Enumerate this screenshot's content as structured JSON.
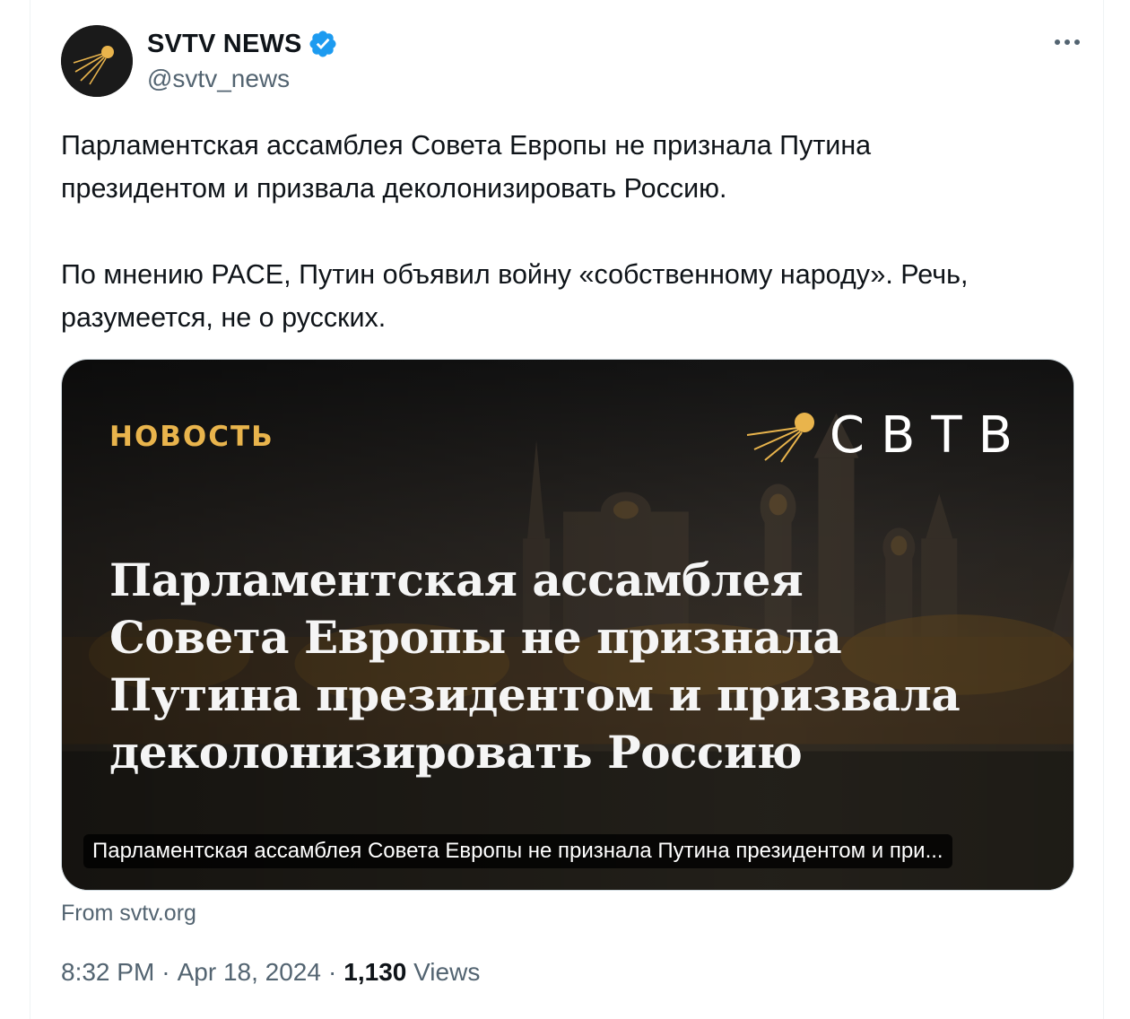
{
  "author": {
    "display_name": "SVTV NEWS",
    "handle": "@svtv_news",
    "verified": true,
    "verified_color": "#1d9bf0"
  },
  "tweet": {
    "text": "Парламентская ассамблея Совета Европы не признала Путина\nпрезидентом и призвала деколонизировать Россию.\n\nПо мнению PACE, Путин объявил войну «собственному народу». Речь,\nразумеется, не о русских."
  },
  "card": {
    "kicker": "НОВОСТЬ",
    "logo_text": "СВТВ",
    "headline": "Парламентская ассамблея Совета Европы не признала Путина президентом и призвала деколонизировать Россию",
    "caption": "Парламентская ассамблея Совета Европы не признала Путина президентом и при...",
    "source": "From svtv.org",
    "accent_color": "#e9b44c"
  },
  "meta": {
    "time": "8:32 PM",
    "separator1": "·",
    "date": "Apr 18, 2024",
    "separator2": "·",
    "views_count": "1,130",
    "views_label": "Views"
  },
  "icons": {
    "more": "more-horizontal-icon",
    "verified": "verified-badge-icon",
    "avatar_logo": "sputnik-logo-icon"
  }
}
